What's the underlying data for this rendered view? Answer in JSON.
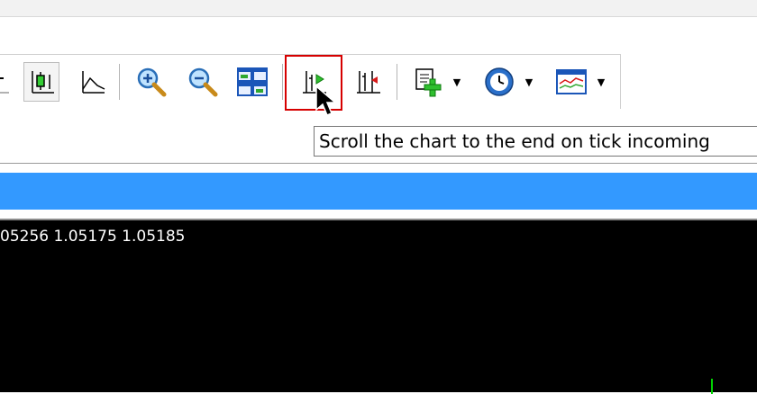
{
  "toolbar": {
    "buttons": [
      {
        "name": "candlesticks-button",
        "icon": "candlestick-icon"
      },
      {
        "name": "line-chart-button",
        "icon": "line-chart-icon"
      },
      {
        "name": "zoom-in-button",
        "icon": "zoom-in-icon"
      },
      {
        "name": "zoom-out-button",
        "icon": "zoom-out-icon"
      },
      {
        "name": "tile-windows-button",
        "icon": "tile-windows-icon"
      },
      {
        "name": "auto-scroll-button",
        "icon": "auto-scroll-icon"
      },
      {
        "name": "chart-shift-button",
        "icon": "chart-shift-icon"
      },
      {
        "name": "indicators-button",
        "icon": "add-indicator-icon"
      },
      {
        "name": "periods-button",
        "icon": "clock-icon"
      },
      {
        "name": "templates-button",
        "icon": "template-icon"
      }
    ]
  },
  "tooltip": {
    "text": "Scroll the chart to the end on tick incoming"
  },
  "chart": {
    "ohlc_text": "05256 1.05175 1.05185"
  },
  "colors": {
    "title_bar": "#3399ff",
    "chart_bg": "#000000",
    "highlight": "#d60000",
    "tick": "#00d000"
  }
}
